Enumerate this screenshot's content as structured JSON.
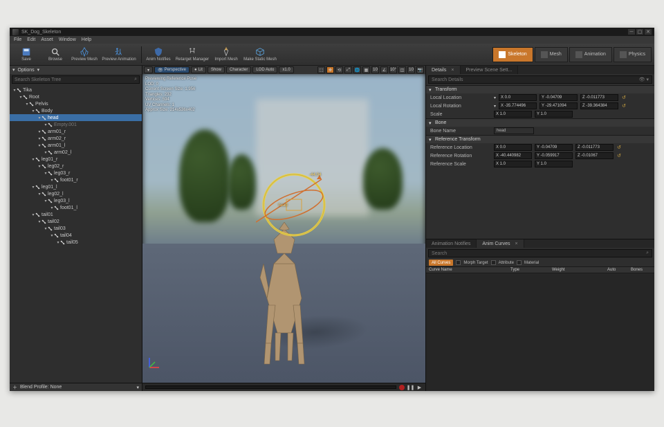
{
  "titlebar": {
    "filename": "SK_Dog_Skeleton"
  },
  "menu": [
    "File",
    "Edit",
    "Asset",
    "Window",
    "Help"
  ],
  "toolbar": [
    {
      "name": "save",
      "label": "Save"
    },
    {
      "name": "browse",
      "label": "Browse"
    },
    {
      "name": "preview-mesh",
      "label": "Preview Mesh"
    },
    {
      "name": "preview-anim",
      "label": "Preview Animation"
    },
    {
      "name": "anim-notifies",
      "label": "Anim Notifies"
    },
    {
      "name": "retarget",
      "label": "Retarget Manager"
    },
    {
      "name": "import-mesh",
      "label": "Import Mesh"
    },
    {
      "name": "make-static",
      "label": "Make Static Mesh"
    }
  ],
  "modes": [
    {
      "name": "skeleton",
      "label": "Skeleton",
      "selected": true
    },
    {
      "name": "mesh",
      "label": "Mesh",
      "selected": false
    },
    {
      "name": "animation",
      "label": "Animation",
      "selected": false
    },
    {
      "name": "physics",
      "label": "Physics",
      "selected": false
    }
  ],
  "tree": {
    "options_label": "Options",
    "search_placeholder": "Search Skeleton Tree",
    "footer": "Blend Profile: None",
    "nodes": [
      {
        "d": 0,
        "label": "Tika"
      },
      {
        "d": 1,
        "label": "Root"
      },
      {
        "d": 2,
        "label": "Pelvis"
      },
      {
        "d": 3,
        "label": "Body"
      },
      {
        "d": 4,
        "label": "head",
        "selected": true
      },
      {
        "d": 5,
        "label": "Empty.001",
        "muted": true
      },
      {
        "d": 4,
        "label": "arm01_r"
      },
      {
        "d": 4,
        "label": "arm02_r"
      },
      {
        "d": 4,
        "label": "arm01_l"
      },
      {
        "d": 5,
        "label": "arm02_l"
      },
      {
        "d": 3,
        "label": "leg01_r"
      },
      {
        "d": 4,
        "label": "leg02_r"
      },
      {
        "d": 5,
        "label": "leg03_r"
      },
      {
        "d": 6,
        "label": "foot01_r"
      },
      {
        "d": 3,
        "label": "leg01_l"
      },
      {
        "d": 4,
        "label": "leg02_l"
      },
      {
        "d": 5,
        "label": "leg03_l"
      },
      {
        "d": 6,
        "label": "foot01_l"
      },
      {
        "d": 3,
        "label": "tail01"
      },
      {
        "d": 4,
        "label": "tail02"
      },
      {
        "d": 5,
        "label": "tail03"
      },
      {
        "d": 6,
        "label": "tail04"
      },
      {
        "d": 7,
        "label": "tail05"
      }
    ]
  },
  "viewport": {
    "buttons": {
      "perspective": "Perspective",
      "lit": "Lit",
      "show": "Show",
      "character": "Character",
      "lod": "LOD Auto",
      "speed": "x1.0"
    },
    "snap": [
      "10",
      "10",
      "10°",
      "10"
    ],
    "overlay": {
      "l1": "Previewing Reference Pose",
      "l2": "LOD: 0",
      "l3": "Current Screen Size: 1.956",
      "l4": "Triangles: 232",
      "l5": "Vertices: 594",
      "l6": "UV Channels: 1",
      "l7": "Approx Size: 214x536x402"
    },
    "gizmo": {
      "value": "-44.04",
      "bone": "head"
    }
  },
  "right": {
    "tabs": {
      "details": "Details",
      "preview": "Preview Scene Sett..."
    },
    "search_placeholder": "Search Details",
    "sec_transform": "Transform",
    "sec_bone": "Bone",
    "sec_ref": "Reference Transform",
    "rows": {
      "loc": {
        "label": "Local Location",
        "x": "X 0.0",
        "y": "Y -0.04709",
        "z": "Z -0.011773"
      },
      "rot": {
        "label": "Local Rotation",
        "x": "X -35.774496",
        "y": "Y -29.471094",
        "z": "Z -39.364384"
      },
      "scale": {
        "label": "Scale",
        "x": "X 1.0",
        "y": "Y 1.0"
      },
      "bone": {
        "label": "Bone Name",
        "value": "head"
      },
      "rloc": {
        "label": "Reference Location",
        "x": "X 0.0",
        "y": "Y -0.04709",
        "z": "Z -0.011773"
      },
      "rrot": {
        "label": "Reference Rotation",
        "x": "X -40.440982",
        "y": "Y -0.059917",
        "z": "Z -0.01067"
      },
      "rscl": {
        "label": "Reference Scale",
        "x": "X 1.0",
        "y": "Y 1.0"
      }
    }
  },
  "bottom": {
    "tabs": {
      "notifies": "Animation Notifies",
      "curves": "Anim Curves"
    },
    "search_placeholder": "Search",
    "filters": {
      "all": "All Curves",
      "morph": "Morph Target",
      "attr": "Attribute",
      "mat": "Material"
    },
    "cols": {
      "name": "Curve Name",
      "type": "Type",
      "weight": "Weight",
      "auto": "Auto",
      "bones": "Bones"
    }
  }
}
